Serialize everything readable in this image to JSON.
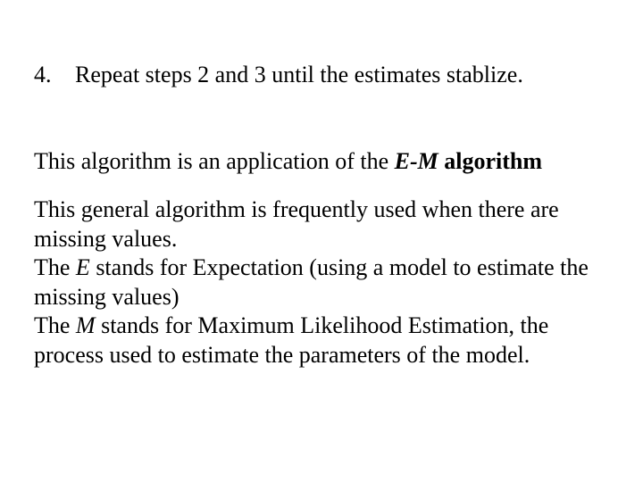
{
  "list": {
    "number": "4.",
    "text": "Repeat steps 2 and 3 until the estimates stablize."
  },
  "para1": {
    "prefix": "This algorithm is an application of the ",
    "em_term": "E-M",
    "bold_term": " algorithm"
  },
  "para2": {
    "l1": "This general algorithm is frequently used when there are missing values.",
    "l2a": "The ",
    "l2e": "E",
    "l2b": " stands for Expectation (using a model to estimate the missing values)",
    "l3a": "The ",
    "l3e": "M",
    "l3b": " stands for Maximum Likelihood Estimation, the process used to estimate the parameters of the model."
  }
}
